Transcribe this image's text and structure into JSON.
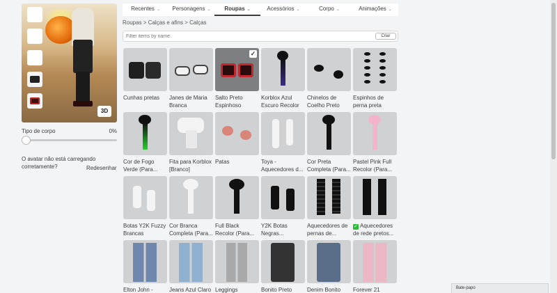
{
  "avatar": {
    "button_3d": "3D",
    "body_type_label": "Tipo de corpo",
    "body_type_value": 0,
    "body_type_display": "0%",
    "loading_message": "O avatar não está carregando corretamente?",
    "redraw_label": "Redesenhar"
  },
  "tabs": [
    {
      "label": "Recentes",
      "active": false
    },
    {
      "label": "Personagens",
      "active": false
    },
    {
      "label": "Roupas",
      "active": true
    },
    {
      "label": "Acessórios",
      "active": false
    },
    {
      "label": "Corpo",
      "active": false
    },
    {
      "label": "Animações",
      "active": false
    }
  ],
  "breadcrumb": {
    "root": "Roupas",
    "sep1": " > ",
    "middle": "Calças e afins",
    "sep2": " > ",
    "current": "Calças"
  },
  "search": {
    "placeholder": "Filter items by name.",
    "button_label": "Criar"
  },
  "items": [
    {
      "name": "Cunhas pretas",
      "selected": false,
      "icon": "black-wedges"
    },
    {
      "name": "Janes de Maria Branca",
      "selected": false,
      "icon": "mary-janes"
    },
    {
      "name": "Salto Preto Espinhoso",
      "selected": true,
      "icon": "spiky-heels"
    },
    {
      "name": "Korblox Azul Escuro Recolor",
      "selected": false,
      "icon": "korblox-leg"
    },
    {
      "name": "Chinelos de Coelho Preto",
      "selected": false,
      "icon": "bunny-slippers"
    },
    {
      "name": "Espinhos de perna preta",
      "selected": false,
      "icon": "leg-spikes"
    },
    {
      "name": "Cor de Fogo Verde (Para...",
      "selected": false,
      "icon": "fire-leg"
    },
    {
      "name": "Fita para Korblox [Branco]",
      "selected": false,
      "icon": "ribbon"
    },
    {
      "name": "Patas",
      "selected": false,
      "icon": "paws"
    },
    {
      "name": "Toya - Aquecedores d...",
      "selected": false,
      "icon": "leg-warmers-white"
    },
    {
      "name": "Cor Preta Completa (Para...",
      "selected": false,
      "icon": "black-leg"
    },
    {
      "name": "Pastel Pink Full Recolor (Para...",
      "selected": false,
      "icon": "pink-leg"
    },
    {
      "name": "Botas Y2K Fuzzy Brancas",
      "selected": false,
      "icon": "white-boots"
    },
    {
      "name": "Cor Branca Completa (Para...",
      "selected": false,
      "icon": "white-leg"
    },
    {
      "name": "Full Black Recolor (Para...",
      "selected": false,
      "icon": "black-leg-full"
    },
    {
      "name": "Y2K Botas Negras...",
      "selected": false,
      "icon": "black-boots"
    },
    {
      "name": "Aquecedores de pernas de...",
      "selected": false,
      "icon": "black-warmers"
    },
    {
      "name": "Aquecedores de rede pretos...",
      "selected": false,
      "icon": "net-stockings",
      "owned_check": true
    },
    {
      "name": "Elton John -",
      "selected": false,
      "icon": "jeans-tall"
    },
    {
      "name": "Jeans Azul Claro",
      "selected": false,
      "icon": "light-jeans"
    },
    {
      "name": "Leggings",
      "selected": false,
      "icon": "leggings"
    },
    {
      "name": "Bonito Preto",
      "selected": false,
      "icon": "black-overalls"
    },
    {
      "name": "Denim Bonito",
      "selected": false,
      "icon": "denim-overalls"
    },
    {
      "name": "Forever 21",
      "selected": false,
      "icon": "pink-pants"
    }
  ],
  "chat": {
    "label": "Bate-papo"
  },
  "colors": {
    "background": "#f2f4f5",
    "thumb": "#cfd1d2",
    "selected_thumb": "#7d7f80",
    "owned_check": "#2ebb3a"
  }
}
